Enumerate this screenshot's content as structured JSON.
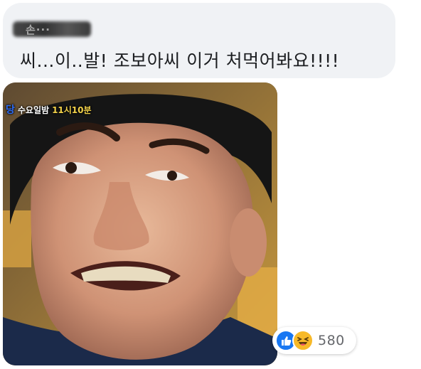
{
  "comment": {
    "author_name": "손···",
    "text": "씨...이..발! 조보아씨 이거 처먹어봐요!!!!"
  },
  "photo": {
    "channel_logo": "당",
    "broadcast_day": "수요일밤",
    "broadcast_time": "11시10분"
  },
  "reactions": {
    "icons": [
      "like-icon",
      "haha-icon"
    ],
    "count": "580",
    "colors": {
      "like": "#1877f2",
      "haha": "#f7b928",
      "count_text": "#65676b"
    }
  },
  "colors": {
    "bubble": "#f0f2f5",
    "text": "#1c1e21"
  }
}
